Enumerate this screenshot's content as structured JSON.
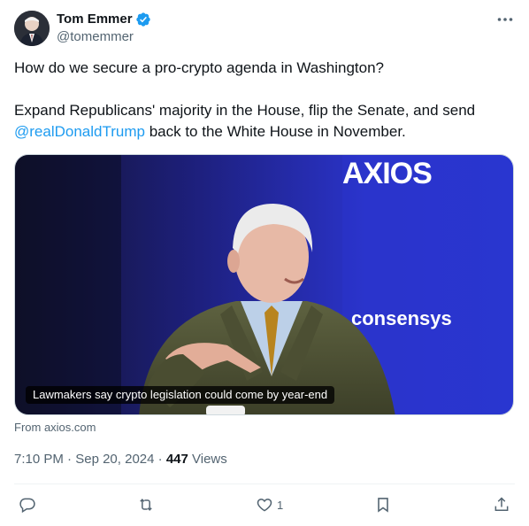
{
  "author": {
    "display_name": "Tom Emmer",
    "handle": "@tomemmer",
    "verified": true,
    "avatar_icon": "avatar-photo"
  },
  "tweet": {
    "line1": "How do we secure a pro-crypto agenda in Washington?",
    "line2_before": "Expand Republicans' majority in the House, flip the Senate, and send ",
    "mention": "@realDonaldTrump",
    "line2_after": " back to the White House in November."
  },
  "card": {
    "caption": "Lawmakers say crypto legislation could come by year-end",
    "backdrop_brand": "AXIOS",
    "backdrop_sponsor": "consensys",
    "source": "From axios.com"
  },
  "meta": {
    "time": "7:10 PM",
    "date": "Sep 20, 2024",
    "separator": "·",
    "views_count": "447",
    "views_label": "Views"
  },
  "actions": {
    "reply_count": "",
    "retweet_count": "",
    "like_count": "1",
    "bookmark_count": ""
  },
  "colors": {
    "accent": "#1d9bf0",
    "text": "#0f1419",
    "muted": "#536471",
    "backdrop_blue": "#2430c8"
  }
}
